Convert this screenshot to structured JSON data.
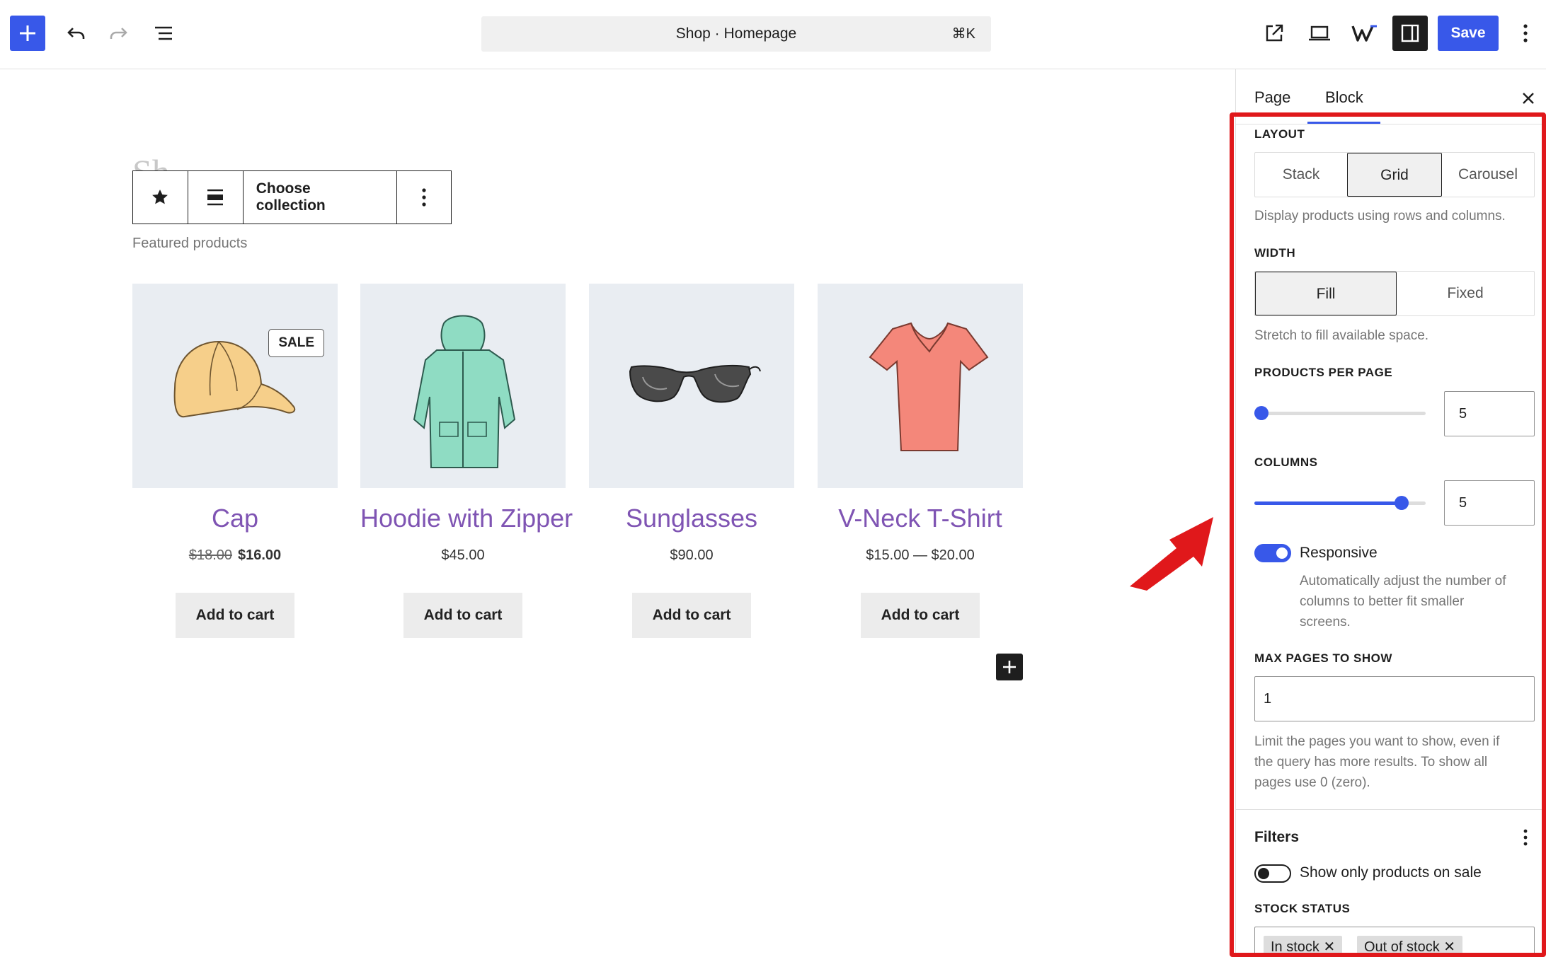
{
  "topbar": {
    "command_title": "Shop · Homepage",
    "command_shortcut": "⌘K",
    "save_label": "Save"
  },
  "canvas": {
    "ghost_title": "Sh",
    "block_toolbar": {
      "choose_collection": "Choose collection"
    },
    "section_label": "Featured products",
    "products": [
      {
        "name": "Cap",
        "regular_price": "$18.00",
        "sale_price": "$16.00",
        "badge": "SALE",
        "cart_label": "Add to cart"
      },
      {
        "name": "Hoodie with Zipper",
        "price": "$45.00",
        "cart_label": "Add to cart"
      },
      {
        "name": "Sunglasses",
        "price": "$90.00",
        "cart_label": "Add to cart"
      },
      {
        "name": "V-Neck T-Shirt",
        "price": "$15.00 — $20.00",
        "cart_label": "Add to cart"
      }
    ]
  },
  "sidebar": {
    "tabs": [
      {
        "label": "Page"
      },
      {
        "label": "Block",
        "active": true
      }
    ],
    "layout": {
      "heading": "LAYOUT",
      "options": [
        "Stack",
        "Grid",
        "Carousel"
      ],
      "selected": "Grid",
      "help": "Display products using rows and columns."
    },
    "width": {
      "heading": "WIDTH",
      "options": [
        "Fill",
        "Fixed"
      ],
      "selected": "Fill",
      "help": "Stretch to fill available space."
    },
    "products_per_page": {
      "heading": "PRODUCTS PER PAGE",
      "value": "5",
      "slider_fraction": 0.03
    },
    "columns": {
      "heading": "COLUMNS",
      "value": "5",
      "slider_fraction": 0.86
    },
    "responsive": {
      "label": "Responsive",
      "enabled": true,
      "help_lines": [
        "Automatically adjust the number of",
        "columns to better fit smaller",
        "screens."
      ]
    },
    "max_pages": {
      "heading": "MAX PAGES TO SHOW",
      "value": "1",
      "help_lines": [
        "Limit the pages you want to show, even if",
        "the query has more results. To show all",
        "pages use 0 (zero)."
      ]
    },
    "filters": {
      "title": "Filters",
      "on_sale_label": "Show only products on sale",
      "on_sale_enabled": false,
      "stock_heading": "STOCK STATUS",
      "stock_tokens": [
        "In stock",
        "Out of stock"
      ]
    }
  },
  "colors": {
    "accent": "#3858e9",
    "annotation": "#e0181b",
    "product_link": "#7f54b3"
  }
}
